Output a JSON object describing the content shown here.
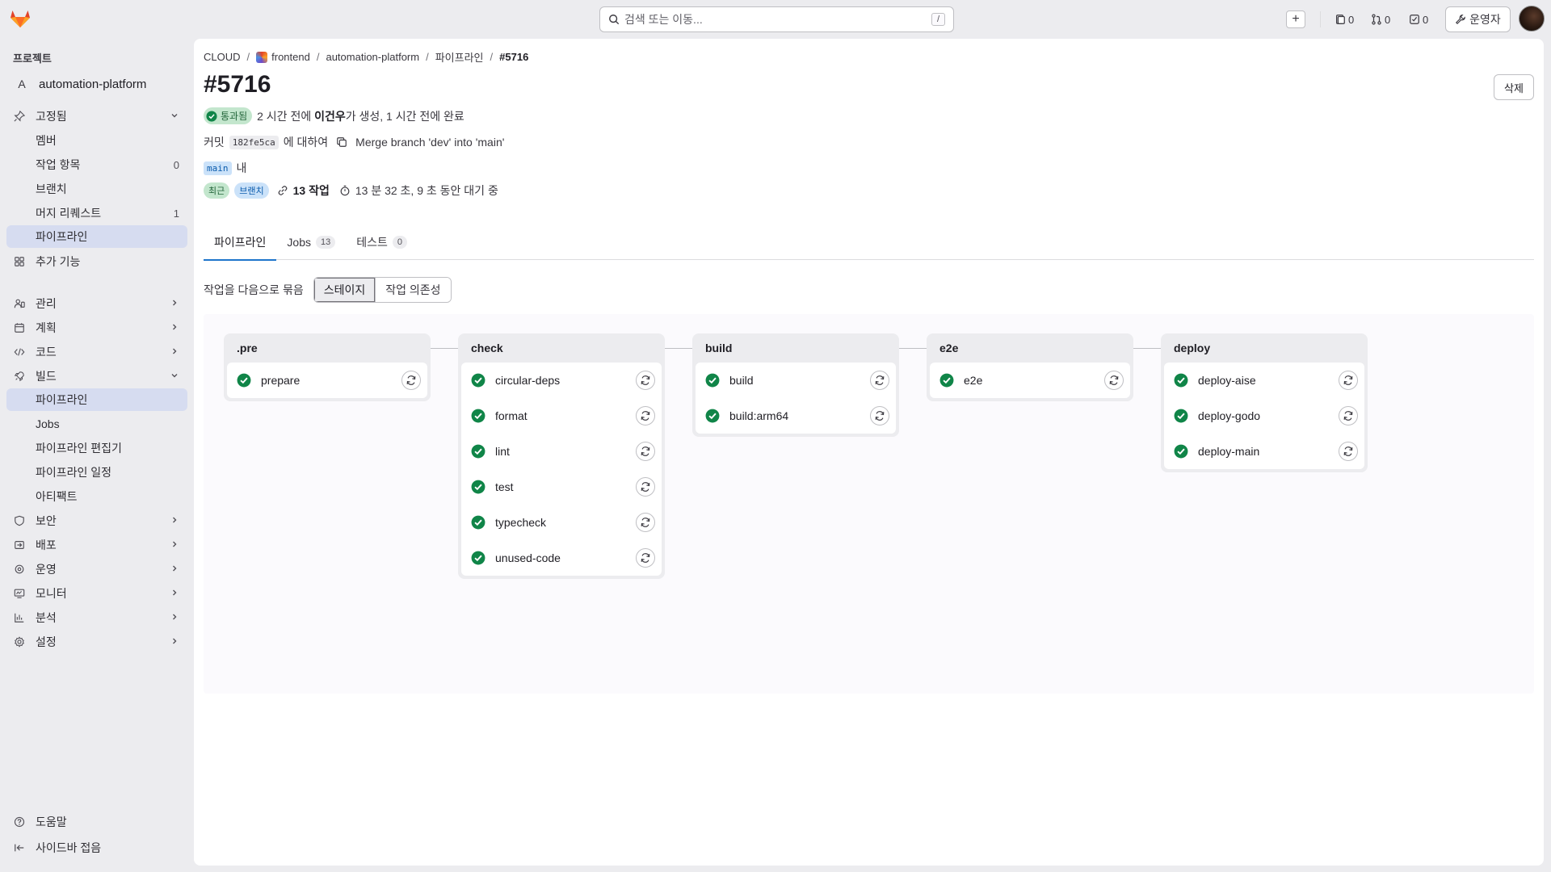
{
  "topbar": {
    "search_placeholder": "검색 또는 이동...",
    "search_shortcut": "/",
    "issues_count": "0",
    "mr_count": "0",
    "todo_count": "0",
    "admin_label": "운영자"
  },
  "sidebar": {
    "section_title": "프로젝트",
    "project_initial": "A",
    "project_name": "automation-platform",
    "pinned_label": "고정됨",
    "pinned_items": [
      {
        "label": "멤버",
        "count": ""
      },
      {
        "label": "작업 항목",
        "count": "0"
      },
      {
        "label": "브랜치",
        "count": ""
      },
      {
        "label": "머지 리퀘스트",
        "count": "1"
      },
      {
        "label": "파이프라인",
        "count": ""
      }
    ],
    "more_features": "추가 기능",
    "groups": [
      {
        "label": "관리"
      },
      {
        "label": "계획"
      },
      {
        "label": "코드"
      },
      {
        "label": "빌드"
      }
    ],
    "build_items": [
      "파이프라인",
      "Jobs",
      "파이프라인 편집기",
      "파이프라인 일정",
      "아티팩트"
    ],
    "groups2": [
      {
        "label": "보안"
      },
      {
        "label": "배포"
      },
      {
        "label": "운영"
      },
      {
        "label": "모니터"
      },
      {
        "label": "분석"
      },
      {
        "label": "설정"
      }
    ],
    "help": "도움말",
    "collapse": "사이드바 접음"
  },
  "breadcrumb": [
    "CLOUD",
    "frontend",
    "automation-platform",
    "파이프라인",
    "#5716"
  ],
  "pipeline": {
    "title": "#5716",
    "delete_label": "삭제",
    "status_badge": "통과됨",
    "created_prefix": "2 시간 전에 ",
    "author": "이건우",
    "created_suffix": "가 생성, 1 시간 전에 완료",
    "commit_label": "커밋",
    "commit_sha": "182fe5ca",
    "commit_for": "에 대하여",
    "commit_message": "Merge branch 'dev' into 'main'",
    "branch": "main",
    "branch_suffix": "내",
    "tag_latest": "최근",
    "tag_branch": "브랜치",
    "jobs_summary": "13 작업",
    "duration": "13 분 32 초, 9 초 동안 대기 중"
  },
  "tabs": [
    {
      "label": "파이프라인",
      "count": ""
    },
    {
      "label": "Jobs",
      "count": "13"
    },
    {
      "label": "테스트",
      "count": "0"
    }
  ],
  "group_by": {
    "label": "작업을 다음으로 묶음",
    "options": [
      "스테이지",
      "작업 의존성"
    ],
    "selected": "스테이지"
  },
  "stages": [
    {
      "name": ".pre",
      "jobs": [
        "prepare"
      ]
    },
    {
      "name": "check",
      "jobs": [
        "circular-deps",
        "format",
        "lint",
        "test",
        "typecheck",
        "unused-code"
      ]
    },
    {
      "name": "build",
      "jobs": [
        "build",
        "build:arm64"
      ]
    },
    {
      "name": "e2e",
      "jobs": [
        "e2e"
      ]
    },
    {
      "name": "deploy",
      "jobs": [
        "deploy-aise",
        "deploy-godo",
        "deploy-main"
      ]
    }
  ],
  "colors": {
    "success": "#108548",
    "accent": "#1f75cb",
    "active_nav": "#d6dcf0"
  }
}
